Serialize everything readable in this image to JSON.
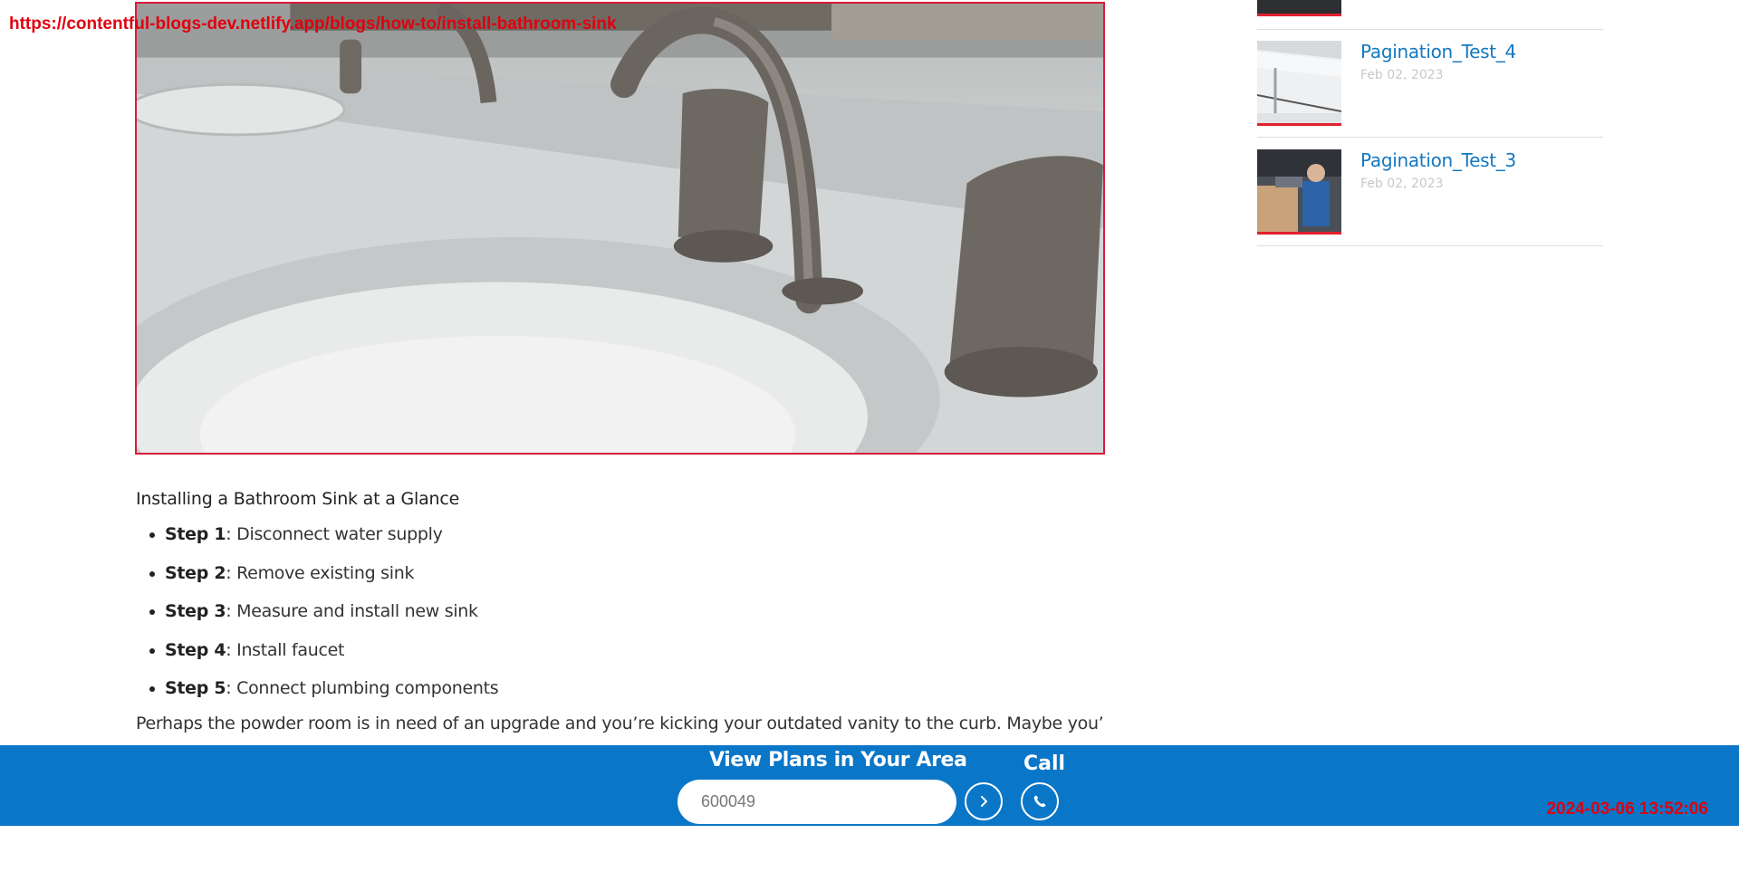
{
  "overlay": {
    "url": "https://contentful-blogs-dev.netlify.app/blogs/how-to/install-bathroom-sink",
    "timestamp": "2024-03-06 13:52:06"
  },
  "hero": {
    "image_description_icon": "bathroom-sink-image",
    "caption": ""
  },
  "article": {
    "glance_title": "Installing a Bathroom Sink at a Glance",
    "steps": [
      {
        "label": "Step 1",
        "text": ": Disconnect water supply"
      },
      {
        "label": "Step 2",
        "text": ": Remove existing sink"
      },
      {
        "label": "Step 3",
        "text": ": Measure and install new sink"
      },
      {
        "label": "Step 4",
        "text": ": Install faucet"
      },
      {
        "label": "Step 5",
        "text": ": Connect plumbing components"
      }
    ],
    "paragraph": "Perhaps the powder room is in need of an upgrade and you’re kicking your outdated vanity to the curb. Maybe you’re"
  },
  "sidebar": {
    "posts": [
      {
        "title": "Pagination_Test_4",
        "date": "Feb 02, 2023",
        "thumb_icon": "house-eaves-thumbnail"
      },
      {
        "title": "Pagination_Test_3",
        "date": "Feb 02, 2023",
        "thumb_icon": "technician-thumbnail"
      }
    ]
  },
  "bottom_bar": {
    "plans_label": "View Plans in Your Area",
    "zip_value": "600049",
    "zip_placeholder": "600049",
    "call_label": "Call",
    "go_icon": "chevron-right-icon",
    "call_icon": "phone-icon"
  },
  "colors": {
    "accent_blue": "#0a76c8",
    "link_blue": "#1478c0",
    "highlight_red": "#e0202e"
  }
}
